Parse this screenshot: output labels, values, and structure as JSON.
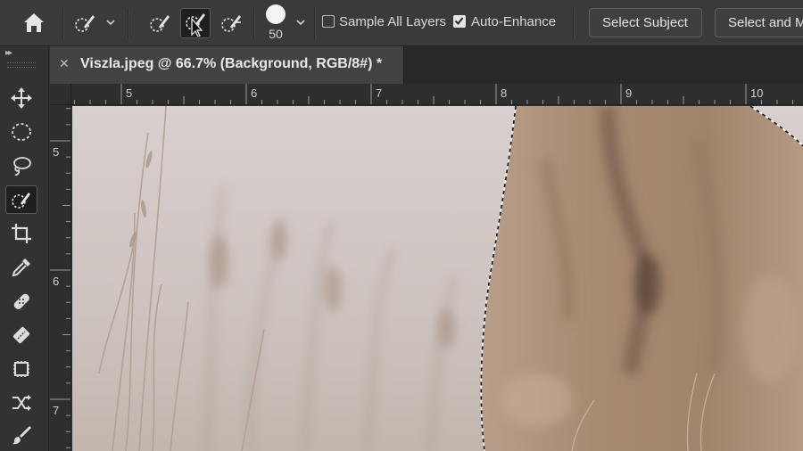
{
  "options_bar": {
    "sample_all_layers": {
      "label": "Sample All Layers",
      "checked": false
    },
    "auto_enhance": {
      "label": "Auto-Enhance",
      "checked": true
    },
    "brush_size": "50",
    "select_subject_label": "Select Subject",
    "select_and_mask_label": "Select and M"
  },
  "document": {
    "tab_title": "Viszla.jpeg @ 66.7% (Background, RGB/8#) *"
  },
  "rulers": {
    "horizontal": [
      "5",
      "6",
      "7",
      "8",
      "9",
      "10"
    ],
    "vertical": [
      "5",
      "6",
      "7"
    ]
  },
  "icons": {
    "home": "home-icon",
    "quick_selection": "quick-selection-icon",
    "new_selection": "brush-new-selection-icon",
    "add_to_selection": "brush-add-selection-icon",
    "subtract_from_selection": "brush-subtract-selection-icon"
  }
}
